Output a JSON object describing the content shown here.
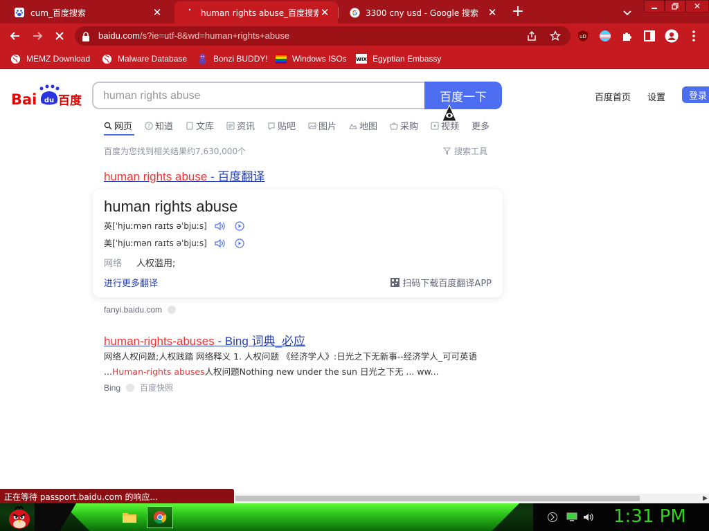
{
  "browser": {
    "tabs": [
      {
        "title": "cum_百度搜索",
        "active": false
      },
      {
        "title": "human rights abuse_百度搜索",
        "active": true
      },
      {
        "title": "3300 cny usd - Google 搜索",
        "active": false
      }
    ],
    "url_host": "baidu.com",
    "url_path": "/s?ie=utf-8&wd=human+rights+abuse",
    "bookmarks": [
      "MEMZ Download",
      "Malware Database",
      "Bonzi BUDDY!",
      "Windows ISOs",
      "Egyptian Embassy"
    ]
  },
  "search": {
    "query": "human rights abuse",
    "button_label": "百度一下",
    "top_links": [
      "百度首页",
      "设置"
    ],
    "login_label": "登录",
    "nav_tabs": [
      "网页",
      "知道",
      "文库",
      "资讯",
      "贴吧",
      "图片",
      "地图",
      "采购",
      "视频",
      "更多"
    ],
    "result_info": "百度为您找到相关结果约7,630,000个",
    "search_tools": "搜索工具"
  },
  "result1": {
    "title_em": "human rights abuse",
    "title_rest": " - 百度翻译",
    "word": "human rights abuse",
    "pron_uk_label": "英",
    "pron_uk": "[ˈhjuːmən raɪts əˈbjuːs]",
    "pron_us_label": "美",
    "pron_us": "[ˈhjuːmən raɪts əˈbjuːs]",
    "net_label": "网络",
    "net_value": "人权滥用;",
    "more_link": "进行更多翻译",
    "app_link": "扫码下载百度翻译APP",
    "source": "fanyi.baidu.com"
  },
  "result2": {
    "title_em": "human-rights-abuses",
    "title_rest": " - Bing 词典_必应",
    "line1": "网络人权问题;人权践踏 网络释义 1. 人权问题 《经济学人》:日光之下无新事--经济学人_可可英语",
    "line2_prefix": "...",
    "line2_em": "Human-rights abuses",
    "line2_rest": "人权问题Nothing new under the sun 日光之下无 ... ww...",
    "source": "Bing",
    "snapshot": "百度快照"
  },
  "status": {
    "text": "正在等待 passport.baidu.com 的响应..."
  },
  "taskbar": {
    "clock": "1:31 PM"
  },
  "colors": {
    "chrome_dark": "#a3141a",
    "chrome": "#c41a20",
    "baidu_blue": "#4e6ef2",
    "link_blue": "#2440b3",
    "highlight_red": "#f73131"
  }
}
